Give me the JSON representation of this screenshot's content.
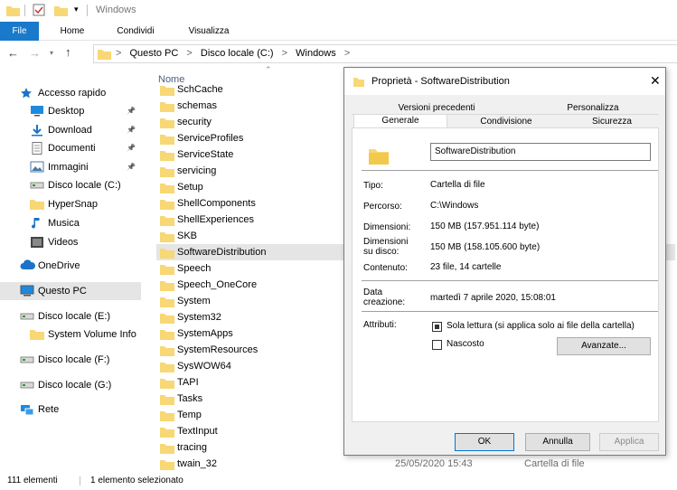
{
  "window": {
    "title": "Windows"
  },
  "ribbon": {
    "tabs": [
      "File",
      "Home",
      "Condividi",
      "Visualizza"
    ]
  },
  "address": {
    "segments": [
      "Questo PC",
      "Disco locale (C:)",
      "Windows"
    ],
    "sep": ">"
  },
  "nav": {
    "items": [
      {
        "label": "Accesso rapido",
        "icon": "star-icon"
      },
      {
        "label": "Desktop",
        "icon": "desktop-icon",
        "pinned": true
      },
      {
        "label": "Download",
        "icon": "download-icon",
        "pinned": true
      },
      {
        "label": "Documenti",
        "icon": "documents-icon",
        "pinned": true
      },
      {
        "label": "Immagini",
        "icon": "pictures-icon",
        "pinned": true
      },
      {
        "label": "Disco locale (C:)",
        "icon": "drive-icon"
      },
      {
        "label": "HyperSnap",
        "icon": "folder-icon"
      },
      {
        "label": "Musica",
        "icon": "music-icon"
      },
      {
        "label": "Videos",
        "icon": "video-icon"
      },
      {
        "label": "OneDrive",
        "icon": "cloud-icon"
      },
      {
        "label": "Questo PC",
        "icon": "computer-icon",
        "selected": true
      },
      {
        "label": "Disco locale (E:)",
        "icon": "drive-icon"
      },
      {
        "label": "System Volume Info",
        "icon": "folder-icon"
      },
      {
        "label": "Disco locale (F:)",
        "icon": "drive-icon"
      },
      {
        "label": "Disco locale (G:)",
        "icon": "drive-icon"
      },
      {
        "label": "Rete",
        "icon": "network-icon"
      }
    ],
    "pin_glyph": "★"
  },
  "list": {
    "column_header": "Nome",
    "files": [
      "SchCache",
      "schemas",
      "security",
      "ServiceProfiles",
      "ServiceState",
      "servicing",
      "Setup",
      "ShellComponents",
      "ShellExperiences",
      "SKB",
      "SoftwareDistribution",
      "Speech",
      "Speech_OneCore",
      "System",
      "System32",
      "SystemApps",
      "SystemResources",
      "SysWOW64",
      "TAPI",
      "Tasks",
      "Temp",
      "TextInput",
      "tracing",
      "twain_32"
    ],
    "selected_index": 10,
    "last_date": "25/05/2020 15:43",
    "last_type": "Cartella di file"
  },
  "status": {
    "count": "111 elementi",
    "selection": "1 elemento selezionato"
  },
  "dialog": {
    "title": "Proprietà - SoftwareDistribution",
    "tabs_back": [
      "Versioni precedenti",
      "Personalizza"
    ],
    "tabs_front": [
      "Generale",
      "Condivisione",
      "Sicurezza"
    ],
    "name_value": "SoftwareDistribution",
    "rows": [
      {
        "label": "Tipo:",
        "value": "Cartella di file"
      },
      {
        "label": "Percorso:",
        "value": "C:\\Windows"
      },
      {
        "label": "Dimensioni:",
        "value": "150 MB (157.951.114 byte)"
      },
      {
        "label": "Dimensioni su disco:",
        "value": "150 MB (158.105.600 byte)"
      },
      {
        "label": "Contenuto:",
        "value": "23 file, 14 cartelle"
      }
    ],
    "created_label": "Data creazione:",
    "created_value": "martedì 7 aprile 2020, 15:08:01",
    "attributes_label": "Attributi:",
    "readonly_label": "Sola lettura (si applica solo ai file della cartella)",
    "hidden_label": "Nascosto",
    "advanced_button": "Avanzate...",
    "ok_button": "OK",
    "cancel_button": "Annulla",
    "apply_button": "Applica"
  },
  "colors": {
    "accent": "#1979ca",
    "folder": "#f8d775",
    "selection": "#e5e5e5"
  }
}
